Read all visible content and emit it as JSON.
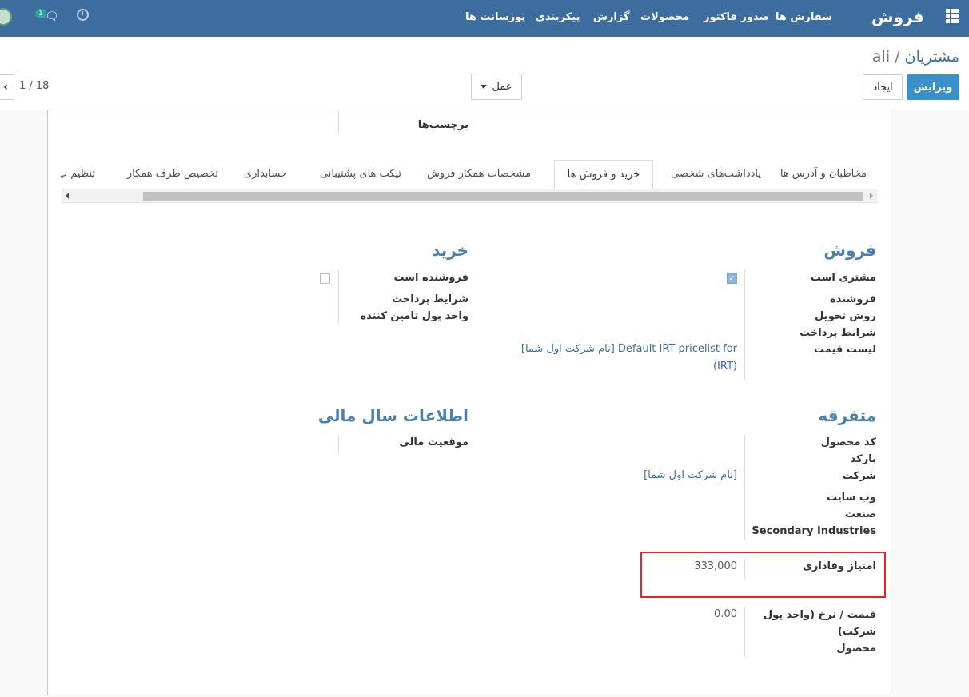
{
  "navbar": {
    "brand": "فروش",
    "menu_items": [
      "سفارش ها",
      "صدور فاکتور",
      "محصولات",
      "گزارش",
      "پیکربندی",
      "پورسانت ها"
    ],
    "chat_badge": "1"
  },
  "control_panel": {
    "breadcrumb_parent": "مشتریان",
    "breadcrumb_separator": "/",
    "breadcrumb_current": "ali",
    "edit_label": "ویرایش",
    "create_label": "ایجاد",
    "action_label": "عمل",
    "pager_value": "1 / 18",
    "pager_prev_glyph": "‹"
  },
  "form": {
    "tags_label": "برچسب‌ها",
    "tabs": [
      "مخاطبان و آدرس ها",
      "یادداشت‌های شخصی",
      "خرید و فروش ها",
      "مشخصات همکار فروش",
      "تیکت های پشتیبانی",
      "حسابداری",
      "تخصیص طرف همکار",
      "تنظیم پ"
    ],
    "active_tab": "خرید و فروش ها",
    "sales": {
      "title": "فروش",
      "is_customer_label": "مشتری است",
      "is_customer": true,
      "salesperson_label": "فروشنده",
      "delivery_method_label": "روش تحویل",
      "payment_terms_label": "شرایط پرداخت",
      "pricelist_label": "لیست قیمت",
      "pricelist_value_line1": "Default IRT pricelist for [نام شرکت اول شما]",
      "pricelist_value_line2": "(IRT)"
    },
    "purchase": {
      "title": "خرید",
      "is_vendor_label": "فروشنده است",
      "is_vendor": false,
      "payment_terms_label": "شرایط پرداخت",
      "supplier_currency_label": "واحد پول تامین کننده"
    },
    "misc": {
      "title": "متفرقه",
      "product_code_label": "کد محصول",
      "barcode_label": "بارکد",
      "company_label": "شرکت",
      "company_value": "[نام شرکت اول شما]",
      "website_label": "وب سایت",
      "industry_label": "صنعت",
      "secondary_industries_label": "Secondary Industries",
      "loyalty_label": "امتیاز وفاداری",
      "loyalty_value": "333,000",
      "price_rate_label_line1": "قیمت / نرخ (واحد پول",
      "price_rate_label_line2": "شرکت)",
      "price_rate_label_line3": "محصول",
      "price_rate_value": "0.00"
    },
    "fiscal": {
      "title": "اطلاعات سال مالی",
      "fiscal_position_label": "موقعیت مالی"
    }
  }
}
